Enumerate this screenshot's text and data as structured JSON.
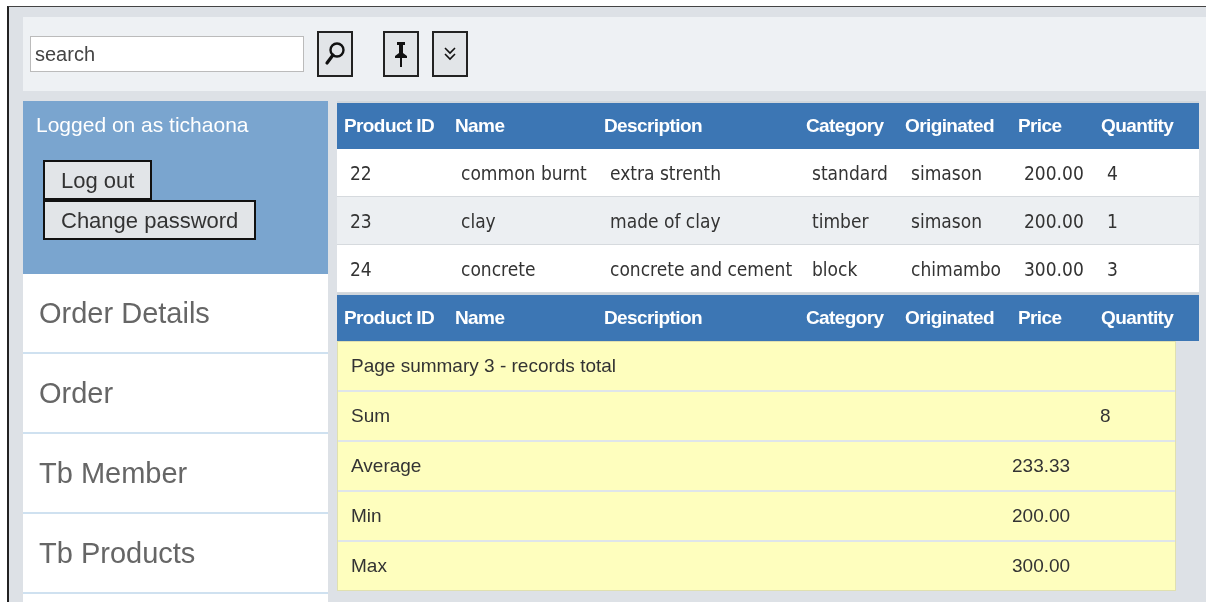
{
  "toolbar": {
    "search": {
      "placeholder": "search"
    }
  },
  "user_panel": {
    "text": "Logged on as tichaona",
    "buttons": [
      "Log out",
      "Change password"
    ]
  },
  "sidebar": {
    "items": [
      {
        "label": "Order Details",
        "selected": false
      },
      {
        "label": "Order",
        "selected": false
      },
      {
        "label": "Tb Member",
        "selected": false
      },
      {
        "label": "Tb Products",
        "selected": false
      }
    ]
  },
  "table": {
    "columns": [
      "Product ID",
      "Name",
      "Description",
      "Category",
      "Originated",
      "Price",
      "Quantity"
    ],
    "rows": [
      [
        "22",
        "common burnt",
        "extra strenth",
        "standard",
        "simason",
        "200.00",
        "4"
      ],
      [
        "23",
        "clay",
        "made of clay",
        "timber",
        "simason",
        "200.00",
        "1"
      ],
      [
        "24",
        "concrete",
        "concrete and cement",
        "block",
        "chimambo",
        "300.00",
        "3"
      ]
    ],
    "footer_columns": [
      "Product ID",
      "Name",
      "Description",
      "Category",
      "Originated",
      "Price",
      "Quantity"
    ]
  },
  "summary": {
    "rows": [
      {
        "label": "Page summary 3 - records total"
      },
      {
        "label": "Sum",
        "quantity": "8"
      },
      {
        "label": "Average",
        "price": "233.33"
      },
      {
        "label": "Min",
        "price": "200.00"
      },
      {
        "label": "Max",
        "price": "300.00"
      }
    ]
  }
}
